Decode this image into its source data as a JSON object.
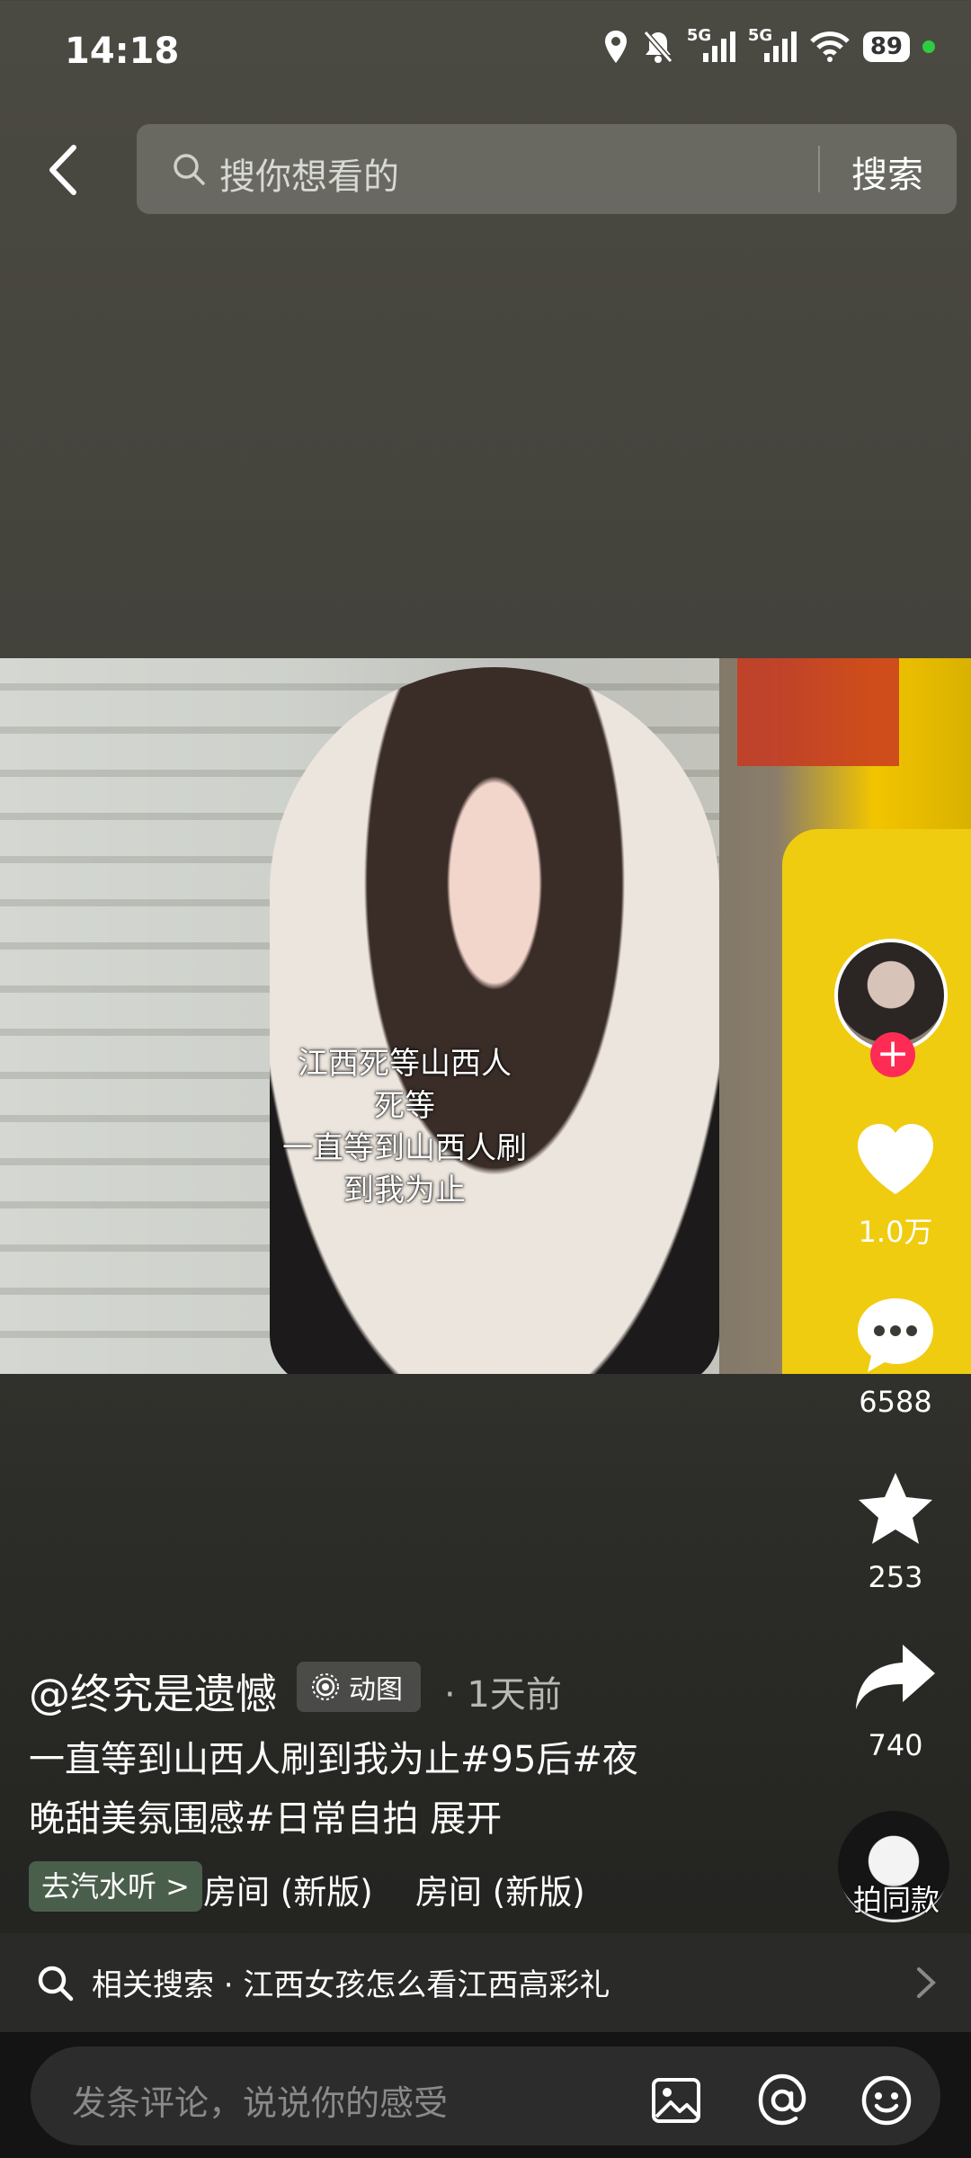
{
  "status_bar": {
    "time": "14:18",
    "network_1": "5G",
    "network_2": "5G",
    "battery": "89"
  },
  "search": {
    "placeholder": "搜你想看的",
    "button_label": "搜索"
  },
  "video": {
    "caption_lines": [
      "江西死等山西人",
      "死等",
      "一直等到山西人刷",
      "到我为止"
    ]
  },
  "actions": {
    "follow_symbol": "+",
    "like_count": "1.0万",
    "comment_count": "6588",
    "favorite_count": "253",
    "share_count": "740",
    "remix_label": "拍同款"
  },
  "post": {
    "username": "@终究是遗憾",
    "badge_label": "动图",
    "time": "· 1天前",
    "description": "一直等到山西人刷到我为止#95后#夜晚甜美氛围感#日常自拍",
    "expand_label": "展开",
    "music_tag": "去汽水听 >",
    "music_title_1": "房间 (新版)",
    "music_title_2": "房间 (新版)"
  },
  "related_search": {
    "text": "相关搜索 · 江西女孩怎么看江西高彩礼"
  },
  "comment_bar": {
    "placeholder": "发条评论，说说你的感受"
  }
}
